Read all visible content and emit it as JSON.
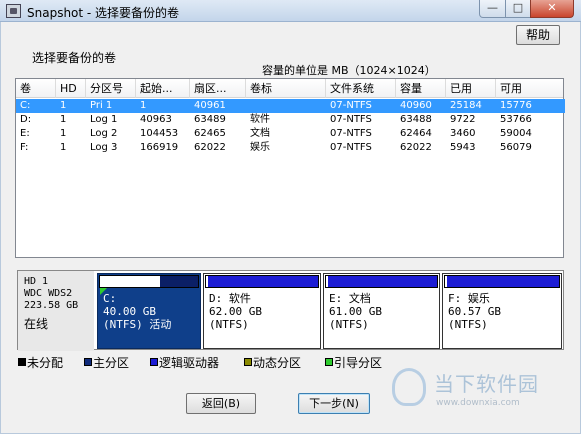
{
  "window": {
    "title": "Snapshot - 选择要备份的卷",
    "min_glyph": "—",
    "max_glyph": "□",
    "close_glyph": "✕"
  },
  "help_button": "帮助",
  "select_label": "选择要备份的卷",
  "unit_label": "容量的单位是 MB（1024×1024）",
  "table": {
    "headers": [
      "卷",
      "HD",
      "分区号",
      "起始...",
      "扇区...",
      "卷标",
      "文件系统",
      "容量",
      "已用",
      "可用"
    ],
    "rows": [
      [
        "C:",
        "1",
        "Pri 1",
        "1",
        "40961",
        "",
        "07-NTFS",
        "40960",
        "25184",
        "15776"
      ],
      [
        "D:",
        "1",
        "Log 1",
        "40963",
        "63489",
        "软件",
        "07-NTFS",
        "63488",
        "9722",
        "53766"
      ],
      [
        "E:",
        "1",
        "Log 2",
        "104453",
        "62465",
        "文档",
        "07-NTFS",
        "62464",
        "3460",
        "59004"
      ],
      [
        "F:",
        "1",
        "Log 3",
        "166919",
        "62022",
        "娱乐",
        "07-NTFS",
        "62022",
        "5943",
        "56079"
      ]
    ],
    "selected_row": 0
  },
  "disk": {
    "line1": "HD 1",
    "line2": "WDC WDS2",
    "line3": "223.58 GB",
    "status": "在线"
  },
  "partitions": [
    {
      "line1": "C:",
      "line2": "40.00 GB",
      "line3": "(NTFS) 活动",
      "used_fraction": 0.61,
      "selected": true
    },
    {
      "line1": "D: 软件",
      "line2": "62.00 GB",
      "line3": "(NTFS)",
      "used_fraction": 0.02,
      "selected": false
    },
    {
      "line1": "E: 文档",
      "line2": "61.00 GB",
      "line3": "(NTFS)",
      "used_fraction": 0.02,
      "selected": false
    },
    {
      "line1": "F: 娱乐",
      "line2": "60.57 GB",
      "line3": "(NTFS)",
      "used_fraction": 0.02,
      "selected": false
    }
  ],
  "legend": [
    {
      "label": "未分配",
      "color": "#000000"
    },
    {
      "label": "主分区",
      "color": "#0f2a7a"
    },
    {
      "label": "逻辑驱动器",
      "color": "#1c1cd4"
    },
    {
      "label": "动态分区",
      "color": "#8a8a00"
    },
    {
      "label": "引导分区",
      "color": "#2ecc2e"
    }
  ],
  "buttons": {
    "back": "返回(B)",
    "next": "下一步(N)"
  },
  "watermark": {
    "text": "当下软件园",
    "url": "www.downxia.com"
  }
}
